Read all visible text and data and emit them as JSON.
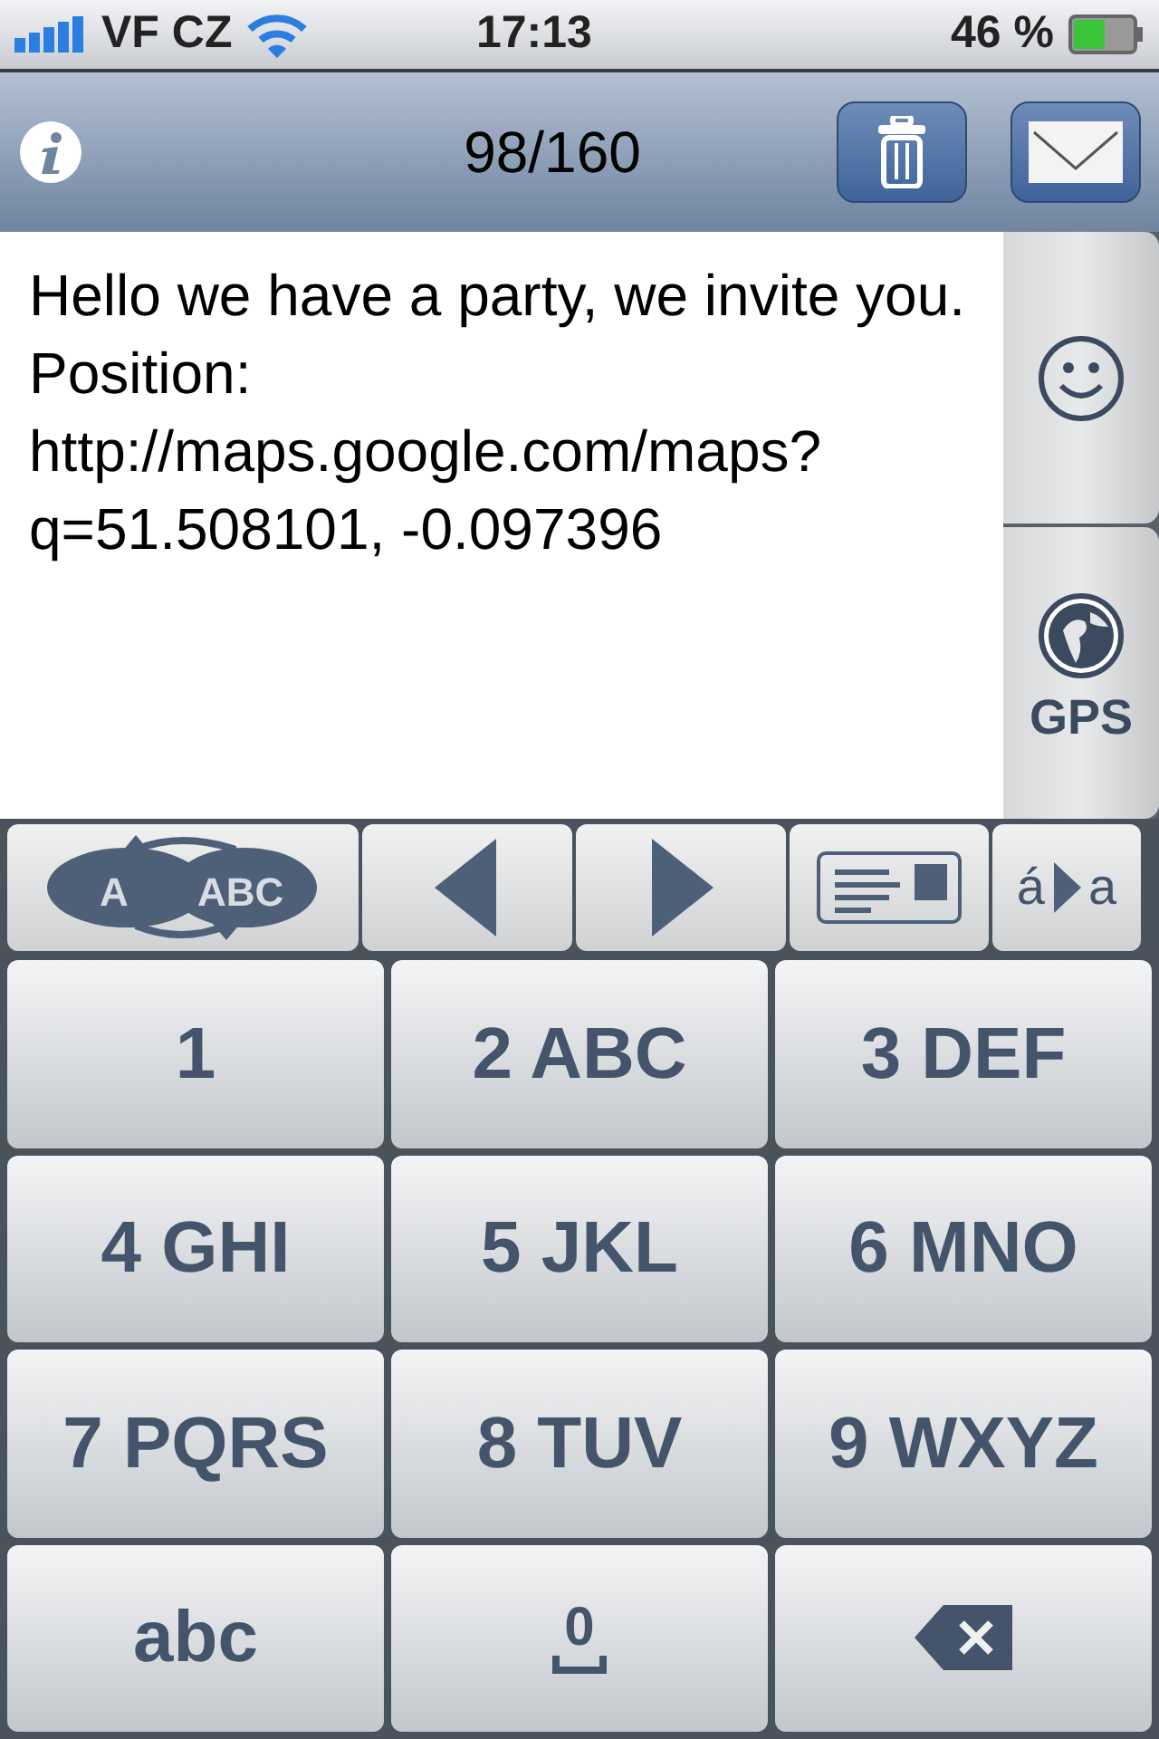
{
  "status_bar": {
    "carrier": "VF CZ",
    "time": "17:13",
    "battery": "46 %"
  },
  "nav_bar": {
    "counter": "98/160"
  },
  "message": {
    "text": "Hello we have a party, we invite you.\nPosition:\nhttp://maps.google.com/maps?\nq=51.508101, -0.097396"
  },
  "side_buttons": [
    {
      "kind": "emoji"
    },
    {
      "kind": "gps",
      "label": "GPS"
    }
  ],
  "toolbar": [
    {
      "kind": "mode",
      "labels": [
        "A",
        "ABC"
      ]
    },
    {
      "kind": "prev"
    },
    {
      "kind": "next"
    },
    {
      "kind": "contact"
    },
    {
      "kind": "accent",
      "labels": [
        "á",
        "a"
      ]
    }
  ],
  "keypad": [
    {
      "kind": "digit",
      "label": "1"
    },
    {
      "kind": "digit",
      "label": "2 ABC"
    },
    {
      "kind": "digit",
      "label": "3 DEF"
    },
    {
      "kind": "digit",
      "label": "4 GHI"
    },
    {
      "kind": "digit",
      "label": "5 JKL"
    },
    {
      "kind": "digit",
      "label": "6 MNO"
    },
    {
      "kind": "digit",
      "label": "7 PQRS"
    },
    {
      "kind": "digit",
      "label": "8 TUV"
    },
    {
      "kind": "digit",
      "label": "9 WXYZ"
    },
    {
      "kind": "text",
      "label": "abc"
    },
    {
      "kind": "space",
      "label": "0"
    },
    {
      "kind": "backspace"
    }
  ]
}
